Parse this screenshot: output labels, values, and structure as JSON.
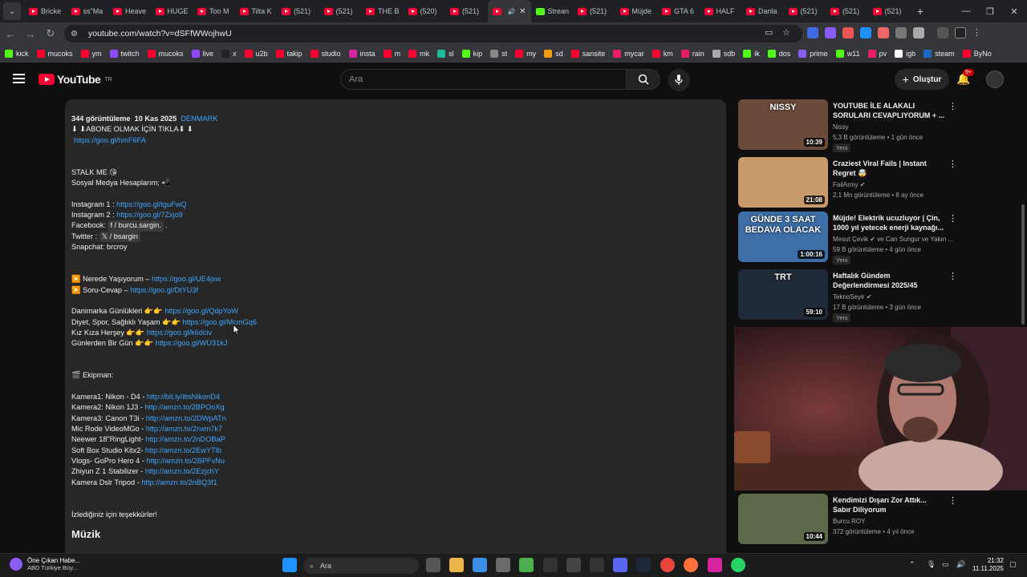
{
  "browser": {
    "tabs": [
      {
        "label": "Bricke",
        "icon": "youtube-icon"
      },
      {
        "label": "ss\"Ma",
        "icon": "youtube-icon"
      },
      {
        "label": "Heave",
        "icon": "youtube-icon"
      },
      {
        "label": "HUGE",
        "icon": "youtube-icon"
      },
      {
        "label": "Too M",
        "icon": "youtube-icon"
      },
      {
        "label": "Tilta K",
        "icon": "youtube-icon"
      },
      {
        "label": "(521)",
        "icon": "youtube-icon"
      },
      {
        "label": "(521)",
        "icon": "youtube-icon"
      },
      {
        "label": "THE B",
        "icon": "youtube-icon"
      },
      {
        "label": "(520)",
        "icon": "youtube-icon"
      },
      {
        "label": "(521)",
        "icon": "youtube-icon"
      },
      {
        "label": "",
        "icon": "youtube-icon",
        "active": true
      },
      {
        "label": "Strean",
        "icon": "kick-icon"
      },
      {
        "label": "(521)",
        "icon": "youtube-icon"
      },
      {
        "label": "Müjde",
        "icon": "youtube-icon"
      },
      {
        "label": "GTA 6",
        "icon": "youtube-icon"
      },
      {
        "label": "HALF",
        "icon": "youtube-icon"
      },
      {
        "label": "Danla",
        "icon": "youtube-icon"
      },
      {
        "label": "(521)",
        "icon": "youtube-icon"
      },
      {
        "label": "(521)",
        "icon": "youtube-icon"
      },
      {
        "label": "(521)",
        "icon": "youtube-icon"
      }
    ],
    "url": "youtube.com/watch?v=dSFfWWojhwU",
    "bookmarks": [
      "kick",
      "mucoks",
      "ym",
      "twitch",
      "mucoks",
      "live",
      "x",
      "u2b",
      "takip",
      "studio",
      "insta",
      "m",
      "mk",
      "sl",
      "kip",
      "st",
      "my",
      "sd",
      "sansite",
      "mycar",
      "km",
      "rain",
      "sdb",
      "ik",
      "dos",
      "prime",
      "w11",
      "pv",
      "igb",
      "steam",
      "ByNo"
    ]
  },
  "youtube": {
    "logo_text": "YouTube",
    "logo_region": "TR",
    "search_placeholder": "Ara",
    "create_label": "Oluştur",
    "notif_count": "9+"
  },
  "description": {
    "meta_views": "344 görüntüleme",
    "meta_date": "10 Kas 2025",
    "meta_tag": "DENMARK",
    "lines": [
      {
        "t": "⬇ ⬇ABONE OLMAK İÇİN TIKLA⬇ ⬇"
      },
      {
        "l": "https://goo.gl/hmF6FA",
        "indent": true
      },
      {
        "gap": true
      },
      {
        "gap": true
      },
      {
        "t": "STALK ME  😘"
      },
      {
        "t": "Sosyal Medya Hesaplarım; 📲"
      },
      {
        "gap": true
      },
      {
        "t": "Instagram 1 : ",
        "l": "https://goo.gl/tguFwQ"
      },
      {
        "t": "Instagram 2 : ",
        "l": "https://goo.gl/7Zxjo9"
      },
      {
        "t": "Facebook: ",
        "p": "f / burcu.sargin.",
        "t2": " ."
      },
      {
        "t": "Twitter : ",
        "p": "𝕏 / bsargin"
      },
      {
        "t": "Snapchat: brcroy"
      },
      {
        "gap": true
      },
      {
        "gap": true
      },
      {
        "t": "▶️ Nerede Yaşıyorum – ",
        "l": "https://goo.gl/UE4jsw"
      },
      {
        "t": "▶️ Soru-Cevap – ",
        "l": "https://goo.gl/DtYU3f"
      },
      {
        "gap": true
      },
      {
        "t": "Danimarka Günlükleri  👉👉 ",
        "l": "https://goo.gl/QdpYoW"
      },
      {
        "t": "Diyet, Spor, Sağlıklı Yaşam  👉👉 ",
        "l": "https://goo.gl/McmGq6"
      },
      {
        "t": "Kız Kıza Herşey  👉👉 ",
        "l": "https://goo.gl/k6dciv"
      },
      {
        "t": "Günlerden Bir Gün  👉👉 ",
        "l": "https://goo.gl/WU31kJ"
      },
      {
        "gap": true
      },
      {
        "gap": true
      },
      {
        "t": "🎬  Ekipman:"
      },
      {
        "gap": true
      },
      {
        "t": "Kamera1: Nikon - D4 - ",
        "l": "http://bit.ly/itisNikonD4"
      },
      {
        "t": "Kamera2: Nikon 1J3 - ",
        "l": "http://amzn.to/2BPOoXg"
      },
      {
        "t": "Kamera3: Canon T3i - ",
        "l": "http://amzn.to/2DWpATn"
      },
      {
        "t": "Mic Rode VideoMGo - ",
        "l": "http://amzn.to/2nxm7k7"
      },
      {
        "t": "Neewer 18\"RingLight- ",
        "l": "http://amzn.to/2nDOBaP"
      },
      {
        "t": "Soft Box Studio Kitx2- ",
        "l": "http://amzn.to/2EwYTlb"
      },
      {
        "t": "Vlogs- GoPro Hero 4 - ",
        "l": "http://amzn.to/2BPFvNu"
      },
      {
        "t": "Zhiyun Z 1 Stabilizer - ",
        "l": "http://amzn.to/2EzjchY"
      },
      {
        "t": "Kamera Dslr Tripod  - ",
        "l": "http://amzn.to/2nBQ3f1"
      },
      {
        "gap": true
      },
      {
        "gap": true
      },
      {
        "t": "İzlediğiniz için teşekkürler!"
      }
    ],
    "section_music": "Müzik"
  },
  "sidebar": [
    {
      "title": "YOUTUBE İLE ALAKALI SORULARI CEVAPLIYORUM + ...",
      "channel": "Nissy",
      "stats": "5,3 B görüntüleme • 1 gün önce",
      "duration": "10:39",
      "new": "Yeni",
      "thumb": "#6b4a3a",
      "thumb_text": "NISSY"
    },
    {
      "title": "Craziest Viral Fails | Instant Regret 🤯",
      "channel": "FailArmy ✔",
      "stats": "2,1 Mn görüntüleme • 8 ay önce",
      "duration": "21:08",
      "new": "",
      "thumb": "#c79a6a",
      "thumb_text": ""
    },
    {
      "title": "Müjde! Elektrik ucuzluyor | Çin, 1000 yıl yetecek enerji kaynağı...",
      "channel": "Mesut Çevik ✔ ve Can Sungur ve Yakın ...",
      "stats": "59 B görüntüleme • 4 gün önce",
      "duration": "1:00:16",
      "new": "Yeni",
      "thumb": "#3d6ea8",
      "thumb_text": "GÜNDE 3 SAAT BEDAVA OLACAK"
    },
    {
      "title": "Haftalık Gündem Değerlendirmesi 2025/45",
      "channel": "TeknoSeyir ✔",
      "stats": "17 B görüntüleme • 3 gün önce",
      "duration": "59:10",
      "new": "Yeni",
      "thumb": "#1e2a38",
      "thumb_text": "TRT"
    },
    {
      "title": "Kendimizi Dışarı Zor Attık... Sabır Diliyorum",
      "channel": "Burcu ROY",
      "stats": "372 görüntüleme • 4 yıl önce",
      "duration": "10:44",
      "new": "",
      "thumb": "#5c6a4a",
      "thumb_text": ""
    }
  ],
  "taskbar": {
    "weather_title": "Öne Çıkan Habe...",
    "weather_sub": "ABD Türkiye Büy...",
    "search_label": "Ara",
    "time": "21:32",
    "date": "11.11.2025"
  }
}
